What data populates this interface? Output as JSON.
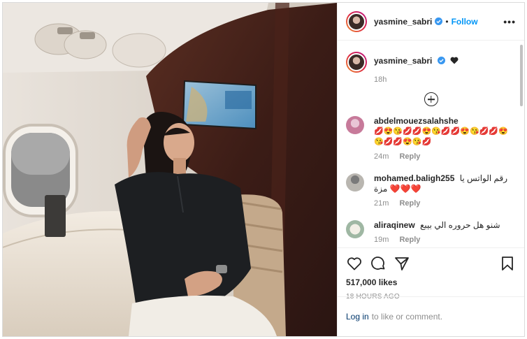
{
  "post": {
    "username": "yasmine_sabri",
    "separator": "•",
    "follow_label": "Follow",
    "more_label": "•••"
  },
  "caption": {
    "username": "yasmine_sabri",
    "time": "18h"
  },
  "comments": [
    {
      "username": "abdelmouezsalahshe",
      "text": "💋😍😘💋💋😍😘💋💋😍😘💋💋😍😘💋💋😍😘💋",
      "time": "24m",
      "reply": "Reply"
    },
    {
      "username": "mohamed.baligh255",
      "text": "رقم الواتس يا مزة ❤️❤️❤️",
      "time": "21m",
      "reply": "Reply"
    },
    {
      "username": "aliraqinew",
      "text": "شنو هل حروره الي بيبع",
      "time": "19m",
      "reply": "Reply"
    }
  ],
  "stats": {
    "likes": "517,000 likes",
    "time_ago": "18 HOURS AGO"
  },
  "login": {
    "link": "Log in",
    "rest": "to like or comment."
  },
  "colors": {
    "link": "#0095f6",
    "secondary": "#8e8e8e",
    "verified": "#3897f0"
  }
}
